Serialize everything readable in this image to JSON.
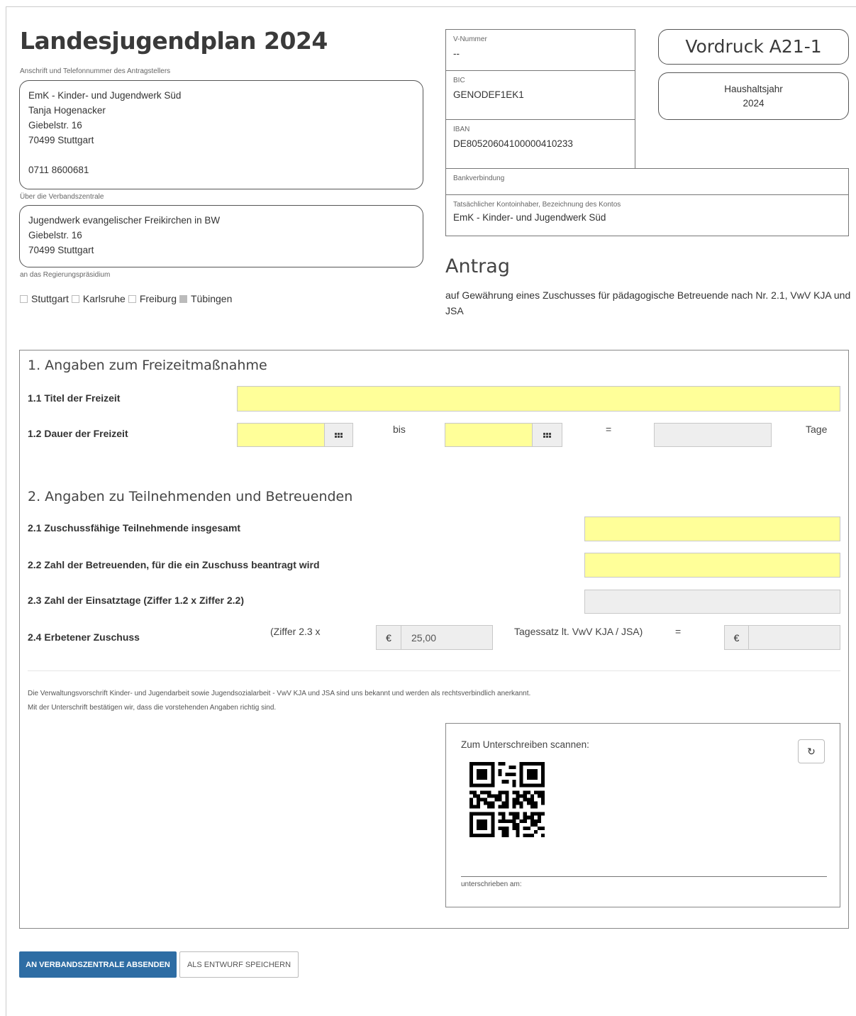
{
  "header": {
    "title": "Landesjugendplan 2024",
    "applicant_label": "Anschrift und Telefonnummer des Antragstellers",
    "applicant_lines": [
      "EmK - Kinder- und Jugendwerk Süd",
      "Tanja Hogenacker",
      "Giebelstr. 16",
      "70499 Stuttgart",
      "",
      "0711 8600681"
    ],
    "central_label": "Über die Verbandszentrale",
    "central_lines": [
      "Jugendwerk evangelischer Freikirchen in BW",
      "Giebelstr. 16",
      "70499 Stuttgart"
    ],
    "rp_label": "an das Regierungspräsidium",
    "rp_options": [
      {
        "label": "Stuttgart",
        "checked": false
      },
      {
        "label": "Karlsruhe",
        "checked": false
      },
      {
        "label": "Freiburg",
        "checked": false
      },
      {
        "label": "Tübingen",
        "checked": true
      }
    ]
  },
  "bank": {
    "v_nummer_label": "V-Nummer",
    "v_nummer_value": "--",
    "bic_label": "BIC",
    "bic_value": "GENODEF1EK1",
    "iban_label": "IBAN",
    "iban_value": "DE80520604100000410233",
    "bankverbindung_label": "Bankverbindung",
    "kontoinhaber_label": "Tatsächlicher Kontoinhaber, Bezeichnung des Kontos",
    "kontoinhaber_value": "EmK - Kinder- und Jugendwerk Süd"
  },
  "vordruck": {
    "label": "Vordruck A21-1",
    "haushaltsjahr_label": "Haushaltsjahr",
    "haushaltsjahr_value": "2024"
  },
  "antrag": {
    "heading": "Antrag",
    "text": "auf Gewährung eines Zuschusses für pädagogische Betreuende nach Nr. 2.1, VwV KJA und JSA"
  },
  "section1": {
    "heading": "1. Angaben zum Freizeitmaßnahme",
    "titel_label": "1.1 Titel der Freizeit",
    "titel_value": "",
    "dauer_label": "1.2 Dauer der Freizeit",
    "bis": "bis",
    "equals": "=",
    "tage": "Tage"
  },
  "section2": {
    "heading": "2. Angaben zu Teilnehmenden und Betreuenden",
    "f21": "2.1 Zuschussfähige Teilnehmende insgesamt",
    "f22": "2.2 Zahl der Betreuenden, für die ein Zuschuss beantragt wird",
    "f23": "2.3 Zahl der Einsatztage (Ziffer 1.2 x Ziffer 2.2)",
    "f24": "2.4 Erbetener Zuschuss",
    "ziffer_text": "(Ziffer 2.3 x",
    "currency": "€",
    "tagessatz_value": "25,00",
    "tagessatz_text": "Tagessatz lt. VwV KJA / JSA)",
    "equals": "="
  },
  "footer": {
    "note1": "Die Verwaltungsvorschrift Kinder- und Jugendarbeit sowie Jugendsozialarbeit - VwV KJA und JSA sind uns bekannt und werden als rechtsverbindlich anerkannt.",
    "note2": "Mit der Unterschrift bestätigen wir, dass die vorstehenden Angaben richtig sind.",
    "scan_label": "Zum Unterschreiben scannen:",
    "signed_label": "unterschrieben am:"
  },
  "actions": {
    "submit": "AN VERBANDSZENTRALE ABSENDEN",
    "draft": "ALS ENTWURF SPEICHERN"
  }
}
